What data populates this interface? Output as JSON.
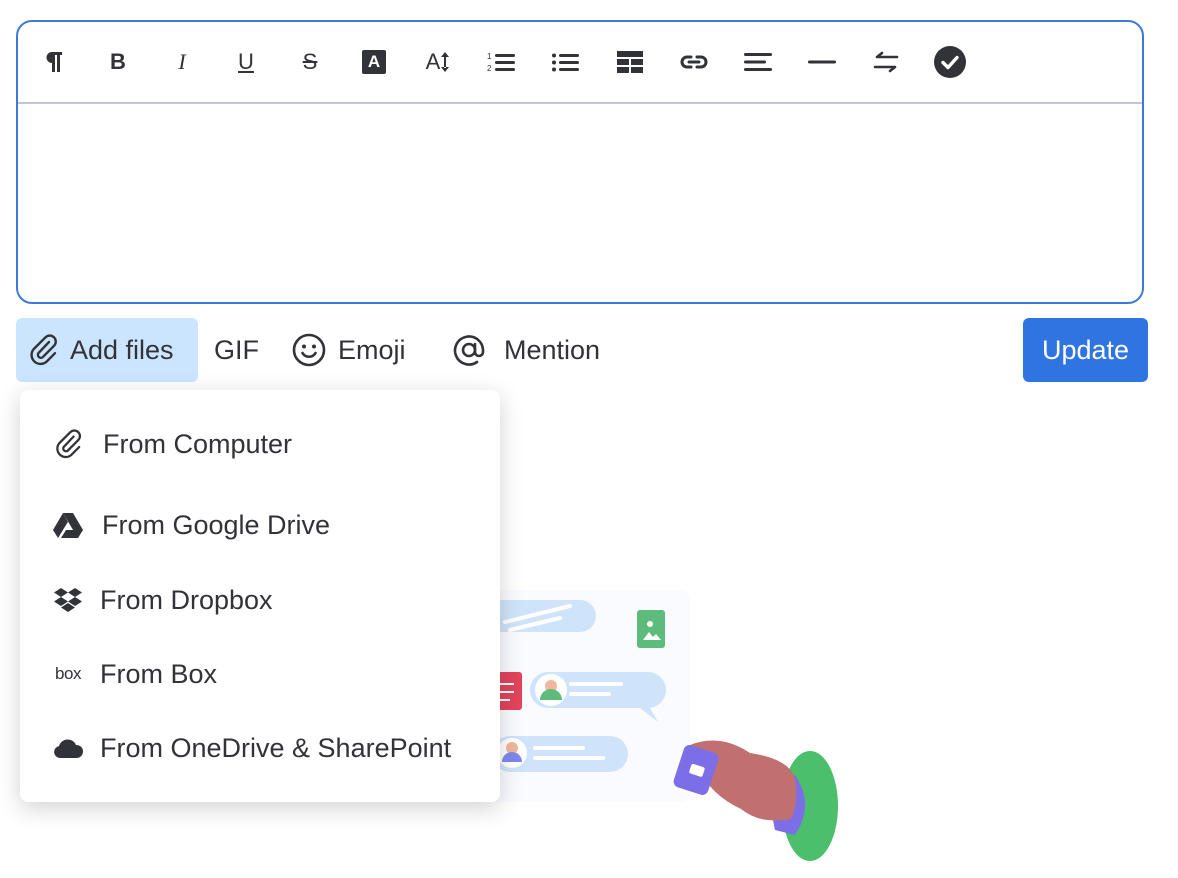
{
  "toolbar": {
    "icons": [
      "paragraph-icon",
      "bold-icon",
      "italic-icon",
      "underline-icon",
      "strikethrough-icon",
      "text-color-icon",
      "font-size-icon",
      "numbered-list-icon",
      "bullet-list-icon",
      "table-icon",
      "link-icon",
      "align-icon",
      "divider-icon",
      "text-direction-icon",
      "checklist-icon"
    ],
    "bold_label": "B",
    "italic_label": "I",
    "underline_label": "U",
    "strike_label": "S",
    "text_color_label": "A",
    "font_size_label": "A"
  },
  "editor": {
    "content": ""
  },
  "actions": {
    "add_files": "Add files",
    "gif": "GIF",
    "emoji": "Emoji",
    "mention": "Mention",
    "update": "Update"
  },
  "menu": {
    "items": [
      {
        "label": "From Computer",
        "icon": "paperclip-icon"
      },
      {
        "label": "From Google Drive",
        "icon": "google-drive-icon"
      },
      {
        "label": "From Dropbox",
        "icon": "dropbox-icon"
      },
      {
        "label": "From Box",
        "icon": "box-icon",
        "icon_text": "box"
      },
      {
        "label": "From OneDrive & SharePoint",
        "icon": "cloud-icon"
      }
    ]
  },
  "colors": {
    "accent": "#2f74e0",
    "editor_border": "#3b7ad9",
    "add_files_bg": "#cce5ff",
    "text": "#323338"
  }
}
